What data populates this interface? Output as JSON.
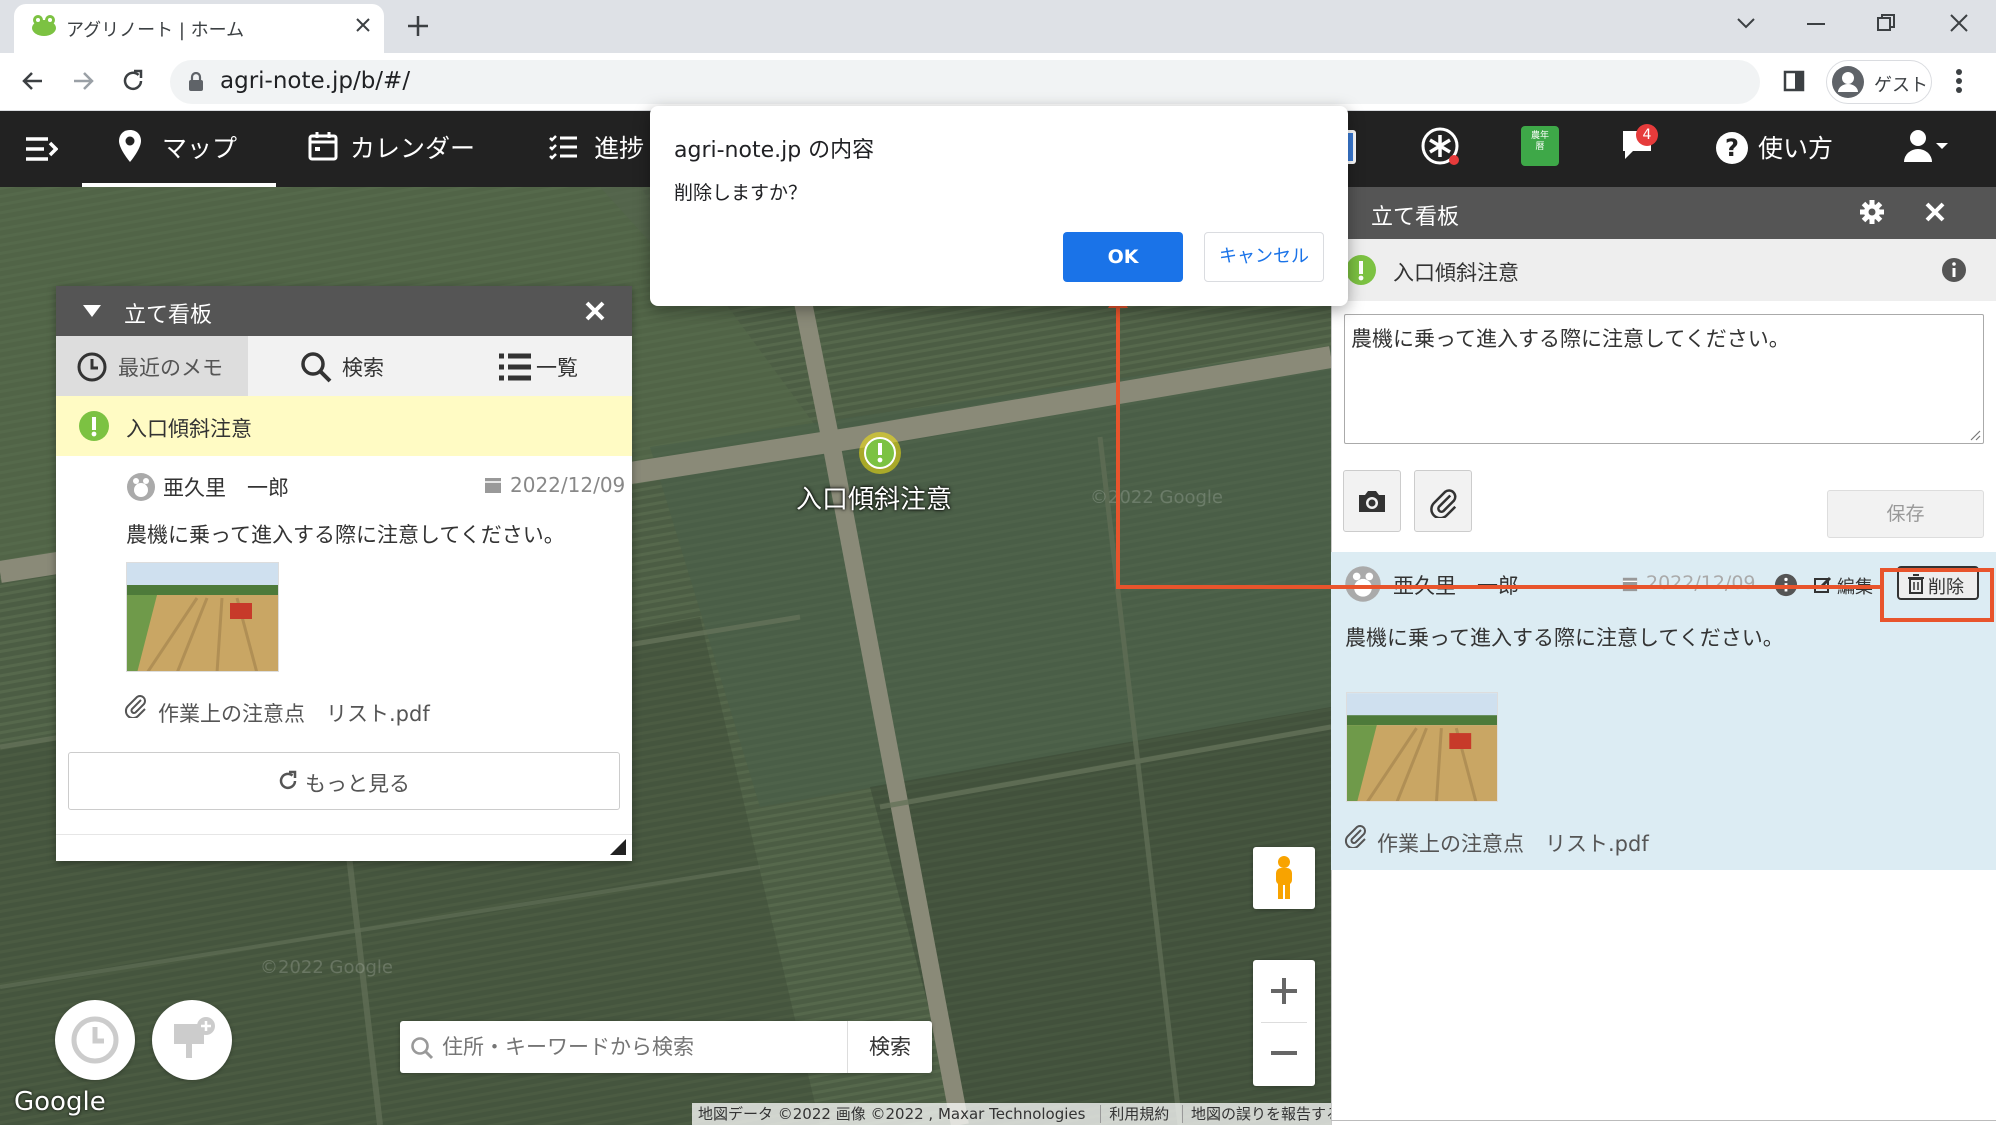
{
  "browser": {
    "tab_title": "アグリノート | ホーム",
    "url": "agri-note.jp/b/#/",
    "profile": "ゲスト"
  },
  "header": {
    "nav": [
      {
        "label": "マップ",
        "icon": "map-pin-icon"
      },
      {
        "label": "カレンダー",
        "icon": "calendar-icon"
      },
      {
        "label": "進捗",
        "icon": "list-icon"
      }
    ],
    "notification_count": "4",
    "help_label": "使い方",
    "calendar_badge_text": "農年\n暦"
  },
  "map": {
    "marker_label": "入口傾斜注意",
    "search_placeholder": "住所・キーワードから検索",
    "search_button": "検索",
    "google_logo": "Google",
    "attribution": "地図データ ©2022 画像 ©2022 , Maxar Technologies",
    "terms": "利用規約",
    "report": "地図の誤りを報告する",
    "watermark": "©2022 Google"
  },
  "left_panel": {
    "title": "立て看板",
    "tabs": [
      {
        "label": "最近のメモ",
        "icon": "clock-icon"
      },
      {
        "label": "検索",
        "icon": "search-icon"
      },
      {
        "label": "一覧",
        "icon": "list-icon"
      }
    ],
    "item_title": "入口傾斜注意",
    "author": "亜久里　一郎",
    "date": "2022/12/09",
    "body": "農機に乗って進入する際に注意してください。",
    "attachment": "作業上の注意点　リスト.pdf",
    "more_button": "もっと見る"
  },
  "right_panel": {
    "title": "立て看板",
    "sign_title": "入口傾斜注意",
    "textarea": "農機に乗って進入する際に注意してください。",
    "save_button": "保存",
    "comment": {
      "author": "亜久里　一郎",
      "date": "2022/12/09",
      "edit": "編集",
      "delete": "削除",
      "body": "農機に乗って進入する際に注意してください。",
      "attachment": "作業上の注意点　リスト.pdf"
    }
  },
  "dialog": {
    "title": "agri-note.jp の内容",
    "message": "削除しますか？",
    "ok": "OK",
    "cancel": "キャンセル"
  },
  "colors": {
    "accent_red": "#e8542c",
    "ok_blue": "#1a73e8",
    "highlight_yellow": "#fffbc4",
    "comment_bg": "#dcecf3",
    "header_dark": "#222222"
  }
}
